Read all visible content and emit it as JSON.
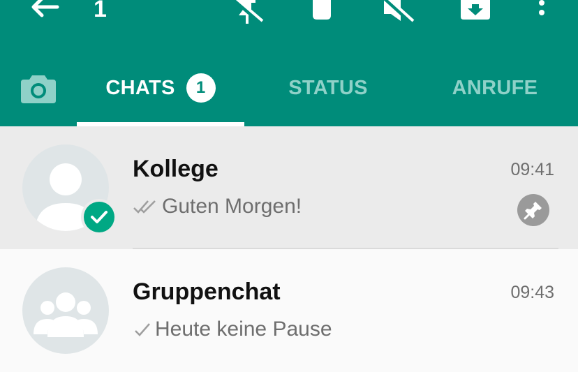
{
  "toolbar": {
    "selected_count": "1",
    "icons": [
      "back-arrow-icon",
      "unpin-icon",
      "delete-icon",
      "unmute-icon",
      "archive-icon",
      "more-icon"
    ]
  },
  "tabs": [
    {
      "label": "CHATS",
      "badge": "1",
      "active": true
    },
    {
      "label": "STATUS",
      "active": false
    },
    {
      "label": "ANRUFE",
      "active": false
    }
  ],
  "chats": [
    {
      "name": "Kollege",
      "time": "09:41",
      "preview": "Guten Morgen!",
      "selected": true,
      "pinned": true
    },
    {
      "name": "Gruppenchat",
      "time": "09:43",
      "preview": "Heute keine Pause"
    }
  ],
  "colors": {
    "primary": "#008c7a",
    "tab_inactive": "#8fd1c8",
    "accent": "#00a884"
  }
}
